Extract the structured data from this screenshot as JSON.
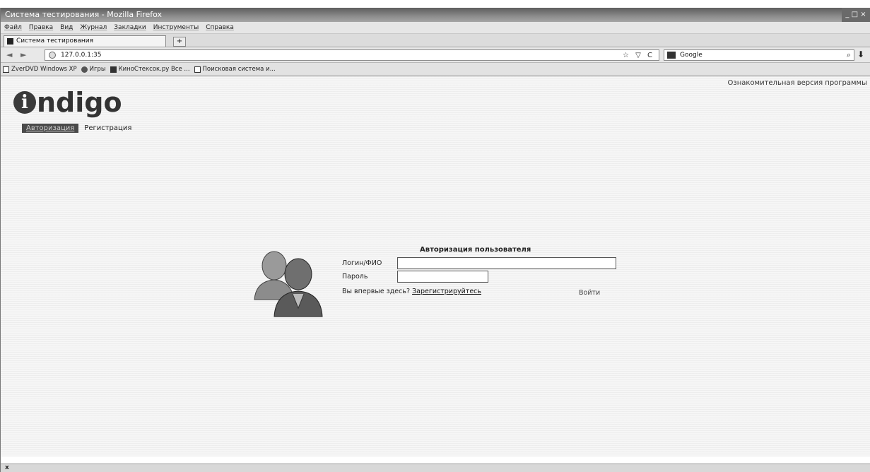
{
  "window": {
    "title": "Система тестирования - Mozilla Firefox",
    "controls": "_ □ ×"
  },
  "menu": [
    "Файл",
    "Правка",
    "Вид",
    "Журнал",
    "Закладки",
    "Инструменты",
    "Справка"
  ],
  "tabs": [
    {
      "label": "Система тестирования",
      "active": true
    }
  ],
  "newtab_label": "+",
  "navigation": {
    "back": "◄",
    "forward": "►",
    "url": "127.0.0.1:35",
    "url_icons": "☆ ▽ C",
    "search_placeholder": "Google",
    "search_icon": "⌕",
    "download_icon": "⬇"
  },
  "bookmarks": [
    {
      "label": "ZverDVD Windows XP",
      "icon": "page-icon"
    },
    {
      "label": "Игры",
      "icon": "games-icon"
    },
    {
      "label": "КиноСтексок.ру Все ...",
      "icon": "film-icon"
    },
    {
      "label": "Поисковая система и...",
      "icon": "search-page-icon"
    }
  ],
  "page": {
    "logo_letter": "i",
    "logo_text": "ndigo",
    "demo_note": "Ознакомительная версия программы",
    "nav_active": "Авторизация",
    "nav_register": "Регистрация",
    "login": {
      "title": "Авторизация пользователя",
      "login_label": "Логин/ФИО",
      "password_label": "Пароль",
      "login_value": "",
      "password_value": "",
      "first_time_text": "Вы впервые здесь?",
      "register_link": "Зарегистрируйтесь",
      "enter_button": "Войти"
    }
  },
  "status": {
    "close": "x"
  }
}
